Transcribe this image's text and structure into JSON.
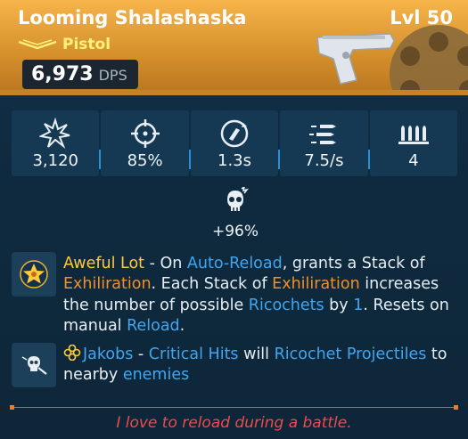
{
  "item": {
    "name": "Looming Shalashaska",
    "level": "Lvl 50",
    "type": "Pistol",
    "dps_value": "6,973",
    "dps_unit": "DPS"
  },
  "stats": [
    {
      "icon": "damage-icon",
      "value": "3,120"
    },
    {
      "icon": "accuracy-icon",
      "value": "85%"
    },
    {
      "icon": "reload-icon",
      "value": "1.3s"
    },
    {
      "icon": "fire-rate-icon",
      "value": "7.5/s"
    },
    {
      "icon": "magazine-icon",
      "value": "4"
    }
  ],
  "element": {
    "icon": "crit-skull-icon",
    "value": "+96%"
  },
  "perks": [
    {
      "icon": "star-badge-icon",
      "segments": [
        {
          "t": "Aweful Lot",
          "c": "y"
        },
        {
          "t": " - On ",
          "c": ""
        },
        {
          "t": "Auto-Reload",
          "c": "b"
        },
        {
          "t": ", grants a Stack of ",
          "c": ""
        },
        {
          "t": "Exhiliration",
          "c": "o"
        },
        {
          "t": ". Each Stack of ",
          "c": ""
        },
        {
          "t": "Exhiliration",
          "c": "o"
        },
        {
          "t": " increases the number of possible ",
          "c": ""
        },
        {
          "t": "Ricochets",
          "c": "b"
        },
        {
          "t": " by ",
          "c": ""
        },
        {
          "t": "1",
          "c": "b"
        },
        {
          "t": ". Resets on manual ",
          "c": ""
        },
        {
          "t": "Reload",
          "c": "b"
        },
        {
          "t": ".",
          "c": ""
        }
      ]
    },
    {
      "icon": "skull-bullet-icon",
      "segments": [
        {
          "t": "Jakobs",
          "c": "b"
        },
        {
          "t": " - ",
          "c": ""
        },
        {
          "t": "Critical Hits",
          "c": "b"
        },
        {
          "t": " will ",
          "c": ""
        },
        {
          "t": "Ricochet Projectiles",
          "c": "b"
        },
        {
          "t": " to nearby ",
          "c": ""
        },
        {
          "t": "enemies",
          "c": "b"
        }
      ]
    }
  ],
  "flavor_text": "I love to reload during a battle.",
  "colors": {
    "header": "#f6b44a",
    "rarity": "#fff27a",
    "keyword_blue": "#41a6f0",
    "keyword_orange": "#f0902a",
    "perk_name": "#ffcb3b",
    "flavor": "#f04a4a"
  }
}
